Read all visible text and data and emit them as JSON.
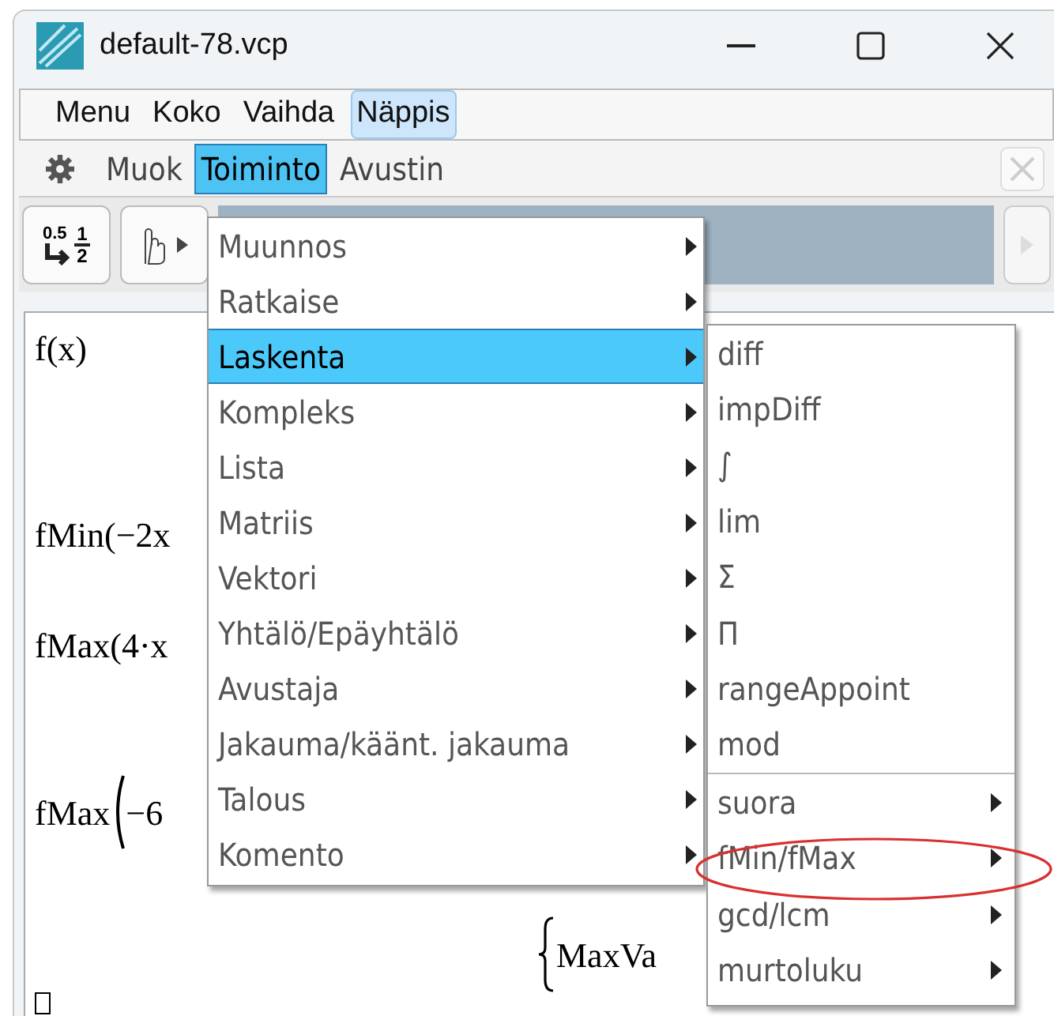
{
  "window": {
    "title": "default-78.vcp"
  },
  "menu_bar": [
    {
      "label": "Menu",
      "selected": false
    },
    {
      "label": "Koko",
      "selected": false
    },
    {
      "label": "Vaihda",
      "selected": false
    },
    {
      "label": "Näppis",
      "selected": true
    }
  ],
  "toolbar_menus": [
    {
      "label": "Muok",
      "selected": false
    },
    {
      "label": "Toiminto",
      "selected": true
    },
    {
      "label": "Avustin",
      "selected": false
    }
  ],
  "toolbar_button": {
    "decimal": "0.5",
    "numerator": "1",
    "denominator": "2"
  },
  "work_area": {
    "lines": [
      {
        "kind": "text",
        "text": "f(x)"
      },
      {
        "kind": "text",
        "text": "fMin(−2x"
      },
      {
        "kind": "text",
        "text": "fMax(4·x"
      },
      {
        "kind": "paren",
        "text": "fMax",
        "tail": "−6"
      },
      {
        "kind": "brace",
        "text": "MaxVa"
      }
    ]
  },
  "menu": [
    {
      "label": "Muunnos",
      "selected": false
    },
    {
      "label": "Ratkaise",
      "selected": false
    },
    {
      "label": "Laskenta",
      "selected": true
    },
    {
      "label": "Kompleks",
      "selected": false
    },
    {
      "label": "Lista",
      "selected": false
    },
    {
      "label": "Matriis",
      "selected": false
    },
    {
      "label": "Vektori",
      "selected": false
    },
    {
      "label": "Yhtälö/Epäyhtälö",
      "selected": false
    },
    {
      "label": "Avustaja",
      "selected": false
    },
    {
      "label": "Jakauma/käänt. jakauma",
      "selected": false
    },
    {
      "label": "Talous",
      "selected": false
    },
    {
      "label": "Komento",
      "selected": false
    }
  ],
  "submenu": [
    {
      "label": "diff",
      "submenu": false,
      "circled": false
    },
    {
      "label": "impDiff",
      "submenu": false,
      "circled": false
    },
    {
      "label": "∫",
      "submenu": false,
      "circled": false
    },
    {
      "label": "lim",
      "submenu": false,
      "circled": false
    },
    {
      "label": "Σ",
      "submenu": false,
      "circled": false
    },
    {
      "label": "Π",
      "submenu": false,
      "circled": false
    },
    {
      "label": "rangeAppoint",
      "submenu": false,
      "circled": false
    },
    {
      "label": "mod",
      "submenu": false,
      "circled": false
    },
    {
      "label": "suora",
      "submenu": true,
      "circled": false
    },
    {
      "label": "fMin/fMax",
      "submenu": true,
      "circled": true
    },
    {
      "label": "gcd/lcm",
      "submenu": true,
      "circled": false
    },
    {
      "label": "murtoluku",
      "submenu": true,
      "circled": false
    }
  ]
}
